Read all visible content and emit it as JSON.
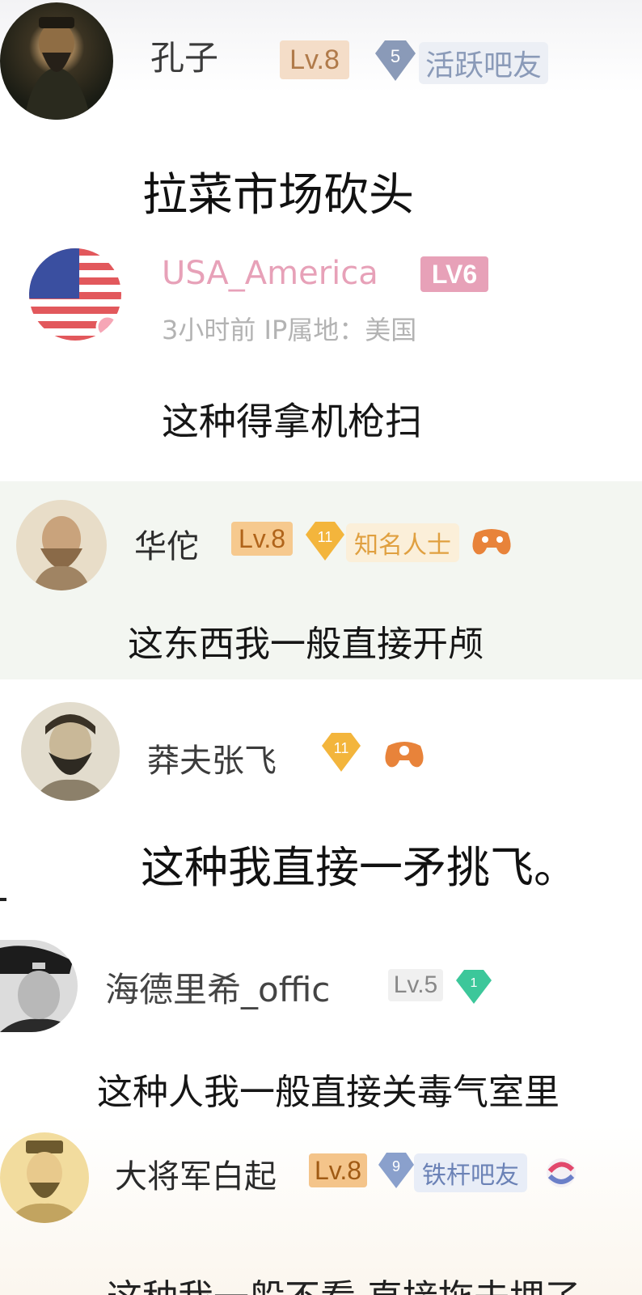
{
  "comments": [
    {
      "username": "孔子",
      "level": "Lv.8",
      "rank_num": "5",
      "rank_title": "活跃吧友",
      "text": "拉菜市场砍头",
      "avatar_icon": "confucius-portrait",
      "accent": "#8a9ab8"
    },
    {
      "username": "USA_America",
      "level": "LV6",
      "meta": "3小时前  IP属地：美国",
      "text": "这种得拿机枪扫",
      "avatar_icon": "us-flag",
      "accent": "#e7a1b8"
    },
    {
      "username": "华佗",
      "level": "Lv.8",
      "rank_num": "11",
      "rank_title": "知名人士",
      "text": "这东西我一般直接开颅",
      "avatar_icon": "hua-tuo-portrait",
      "accent": "#f3b53c"
    },
    {
      "username": "莽夫张飞",
      "rank_num": "11",
      "text": "这种我直接一矛挑飞。",
      "avatar_icon": "zhang-fei-portrait",
      "accent": "#f3b53c"
    },
    {
      "username": "海德里希_offic",
      "level": "Lv.5",
      "rank_num": "1",
      "text": "这种人我一般直接关毒气室里",
      "avatar_icon": "officer-portrait",
      "accent": "#3cc79a"
    },
    {
      "username": "大将军白起",
      "level": "Lv.8",
      "rank_num": "9",
      "rank_title": "铁杆吧友",
      "text": "这种我一般不看 直接拖去埋了",
      "avatar_icon": "bai-qi-portrait",
      "accent": "#8aa0cc"
    }
  ]
}
